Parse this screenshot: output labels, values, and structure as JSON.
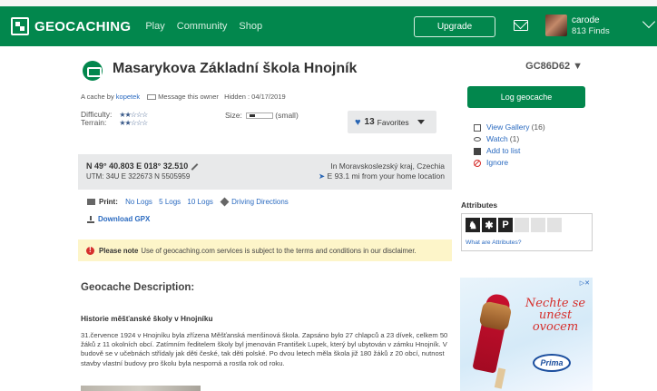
{
  "header": {
    "logo": "GEOCACHING",
    "nav": [
      "Play",
      "Community",
      "Shop"
    ],
    "upgrade": "Upgrade",
    "user_name": "carode",
    "user_finds": "813 Finds"
  },
  "cache": {
    "title": "Masarykova Základní škola Hnojník",
    "gc_code": "GC86D62 ▼",
    "by_prefix": "A cache by",
    "owner": "kopetek",
    "message": "Message this owner",
    "hidden": "Hidden : 04/17/2019",
    "difficulty_label": "Difficulty:",
    "terrain_label": "Terrain:",
    "difficulty_stars": "★★☆☆☆",
    "terrain_stars": "★★☆☆☆",
    "size_label": "Size:",
    "size_value": "(small)",
    "favorites_count": "13",
    "favorites_label": "Favorites"
  },
  "coords": {
    "latlon": "N 49° 40.803 E 018° 32.510",
    "utm": "UTM: 34U E 322673 N 5505959",
    "region": "In Moravskoslezský kraj, Czechia",
    "distance": "E 93.1 mi from your home location"
  },
  "print": {
    "label": "Print:",
    "no_logs": "No Logs",
    "five_logs": "5 Logs",
    "ten_logs": "10 Logs",
    "driving": "Driving Directions",
    "gpx": "Download GPX"
  },
  "note": {
    "bold": "Please note",
    "text": "Use of geocaching.com services is subject to the terms and conditions in our disclaimer."
  },
  "description": {
    "heading": "Geocache Description:",
    "subheading": "Historie měšťanské školy v Hnojníku",
    "paragraph": "31.července 1924 v Hnojníku byla zřízena Měšťanská menšinová škola. Zapsáno bylo 27 chlapců a 23 dívek, celkem 50 žáků z 11 okolních obcí. Zatímním ředitelem školy byl jmenován František Lupek, který byl ubytován v zámku Hnojník. V budově se v učebnách střídaly jak děti české, tak děti polské. Po dvou letech měla škola již 180 žáků z 20 obcí, nutnost stavby vlastní budovy pro školu byla nesporná a rostla rok od roku."
  },
  "sidebar": {
    "log_button": "Log geocache",
    "view_gallery": "View Gallery",
    "gallery_count": "(16)",
    "watch": "Watch",
    "watch_count": "(1)",
    "add_to_list": "Add to list",
    "ignore": "Ignore",
    "attributes_heading": "Attributes",
    "attr_letter": "P",
    "attributes_link": "What are Attributes?"
  },
  "ad": {
    "slogan": "Nechte se unést ovocem",
    "brand": "Prima"
  }
}
